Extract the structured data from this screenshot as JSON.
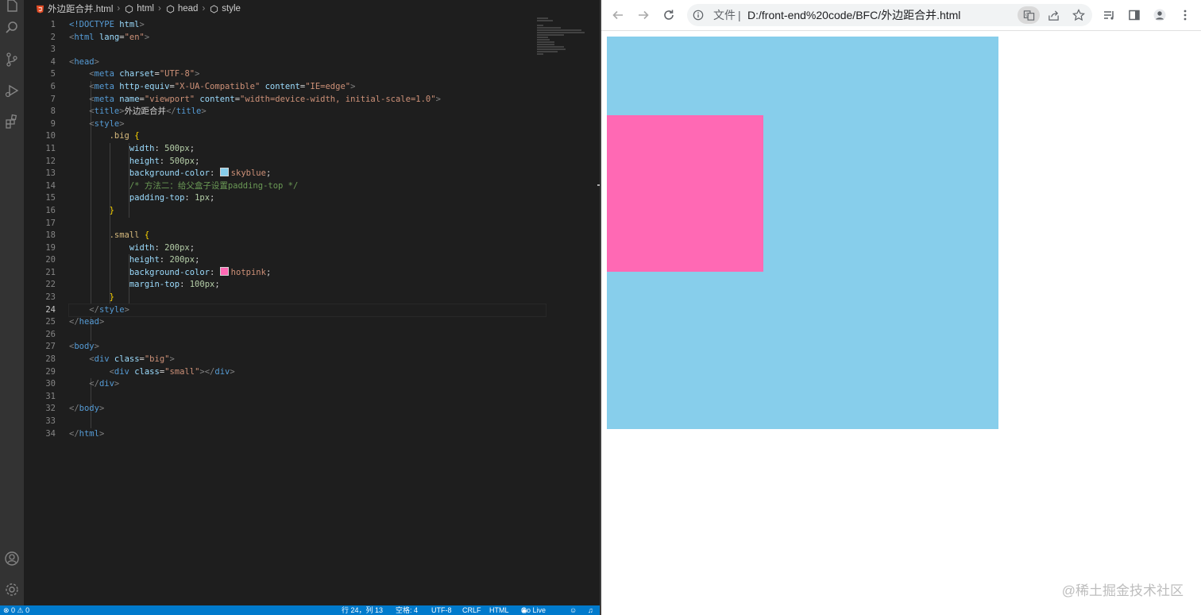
{
  "editor": {
    "breadcrumb": {
      "file": "外边距合并.html",
      "items": [
        "html",
        "head",
        "style"
      ]
    },
    "line_numbers": [
      "1",
      "2",
      "3",
      "4",
      "5",
      "6",
      "7",
      "8",
      "9",
      "10",
      "11",
      "12",
      "13",
      "14",
      "15",
      "16",
      "17",
      "18",
      "19",
      "20",
      "21",
      "22",
      "23",
      "24",
      "25",
      "26",
      "27",
      "28",
      "29",
      "30",
      "31",
      "32",
      "33",
      "34"
    ],
    "current_line": "24",
    "code": {
      "l1": [
        "<!DOCTYPE ",
        "html",
        ">"
      ],
      "l2": [
        "<",
        "html",
        " ",
        "lang",
        "=",
        "\"en\"",
        ">"
      ],
      "l4": [
        "<",
        "head",
        ">"
      ],
      "l5": [
        "<",
        "meta",
        " ",
        "charset",
        "=",
        "\"UTF-8\"",
        ">"
      ],
      "l6": [
        "<",
        "meta",
        " ",
        "http-equiv",
        "=",
        "\"X-UA-Compatible\"",
        " ",
        "content",
        "=",
        "\"IE=edge\"",
        ">"
      ],
      "l7": [
        "<",
        "meta",
        " ",
        "name",
        "=",
        "\"viewport\"",
        " ",
        "content",
        "=",
        "\"width=device-width, initial-scale=1.0\"",
        ">"
      ],
      "l8": [
        "<",
        "title",
        ">",
        "外边距合并",
        "</",
        "title",
        ">"
      ],
      "l9": [
        "<",
        "style",
        ">"
      ],
      "l10": [
        ".big",
        " {"
      ],
      "l11": [
        "width",
        ": ",
        "500px",
        ";"
      ],
      "l12": [
        "height",
        ": ",
        "500px",
        ";"
      ],
      "l13": [
        "background-color",
        ": ",
        "skyblue",
        ";"
      ],
      "l14": [
        "/* 方法二：给父盒子设置padding-top */"
      ],
      "l15": [
        "padding-top",
        ": ",
        "1px",
        ";"
      ],
      "l16": [
        "}"
      ],
      "l18": [
        ".small",
        " {"
      ],
      "l19": [
        "width",
        ": ",
        "200px",
        ";"
      ],
      "l20": [
        "height",
        ": ",
        "200px",
        ";"
      ],
      "l21": [
        "background-color",
        ": ",
        "hotpink",
        ";"
      ],
      "l22": [
        "margin-top",
        ": ",
        "100px",
        ";"
      ],
      "l23": [
        "}"
      ],
      "l24": [
        "</",
        "style",
        ">"
      ],
      "l25": [
        "</",
        "head",
        ">"
      ],
      "l27": [
        "<",
        "body",
        ">"
      ],
      "l28": [
        "<",
        "div",
        " ",
        "class",
        "=",
        "\"big\"",
        ">"
      ],
      "l29": [
        "<",
        "div",
        " ",
        "class",
        "=",
        "\"small\"",
        "></",
        "div",
        ">"
      ],
      "l30": [
        "</",
        "div",
        ">"
      ],
      "l32": [
        "</",
        "body",
        ">"
      ],
      "l34": [
        "</",
        "html",
        ">"
      ]
    },
    "status": {
      "problems": "⊗ 0 ⚠ 0",
      "position": "行 24，列 13",
      "spaces": "空格: 4",
      "encoding": "UTF-8",
      "eol": "CRLF",
      "language": "HTML",
      "golive": "Go Live"
    }
  },
  "browser": {
    "omnibox": {
      "scheme_label": "文件",
      "divider": "|",
      "url": "D:/front-end%20code/BFC/外边距合并.html"
    },
    "page_colors": {
      "big": "#87ceeb",
      "small": "#ff69b4"
    }
  },
  "watermark": "@稀土掘金技术社区",
  "colors": {
    "status_bar": "#007acc",
    "activity_bar": "#333333",
    "editor_bg": "#1e1e1e"
  }
}
